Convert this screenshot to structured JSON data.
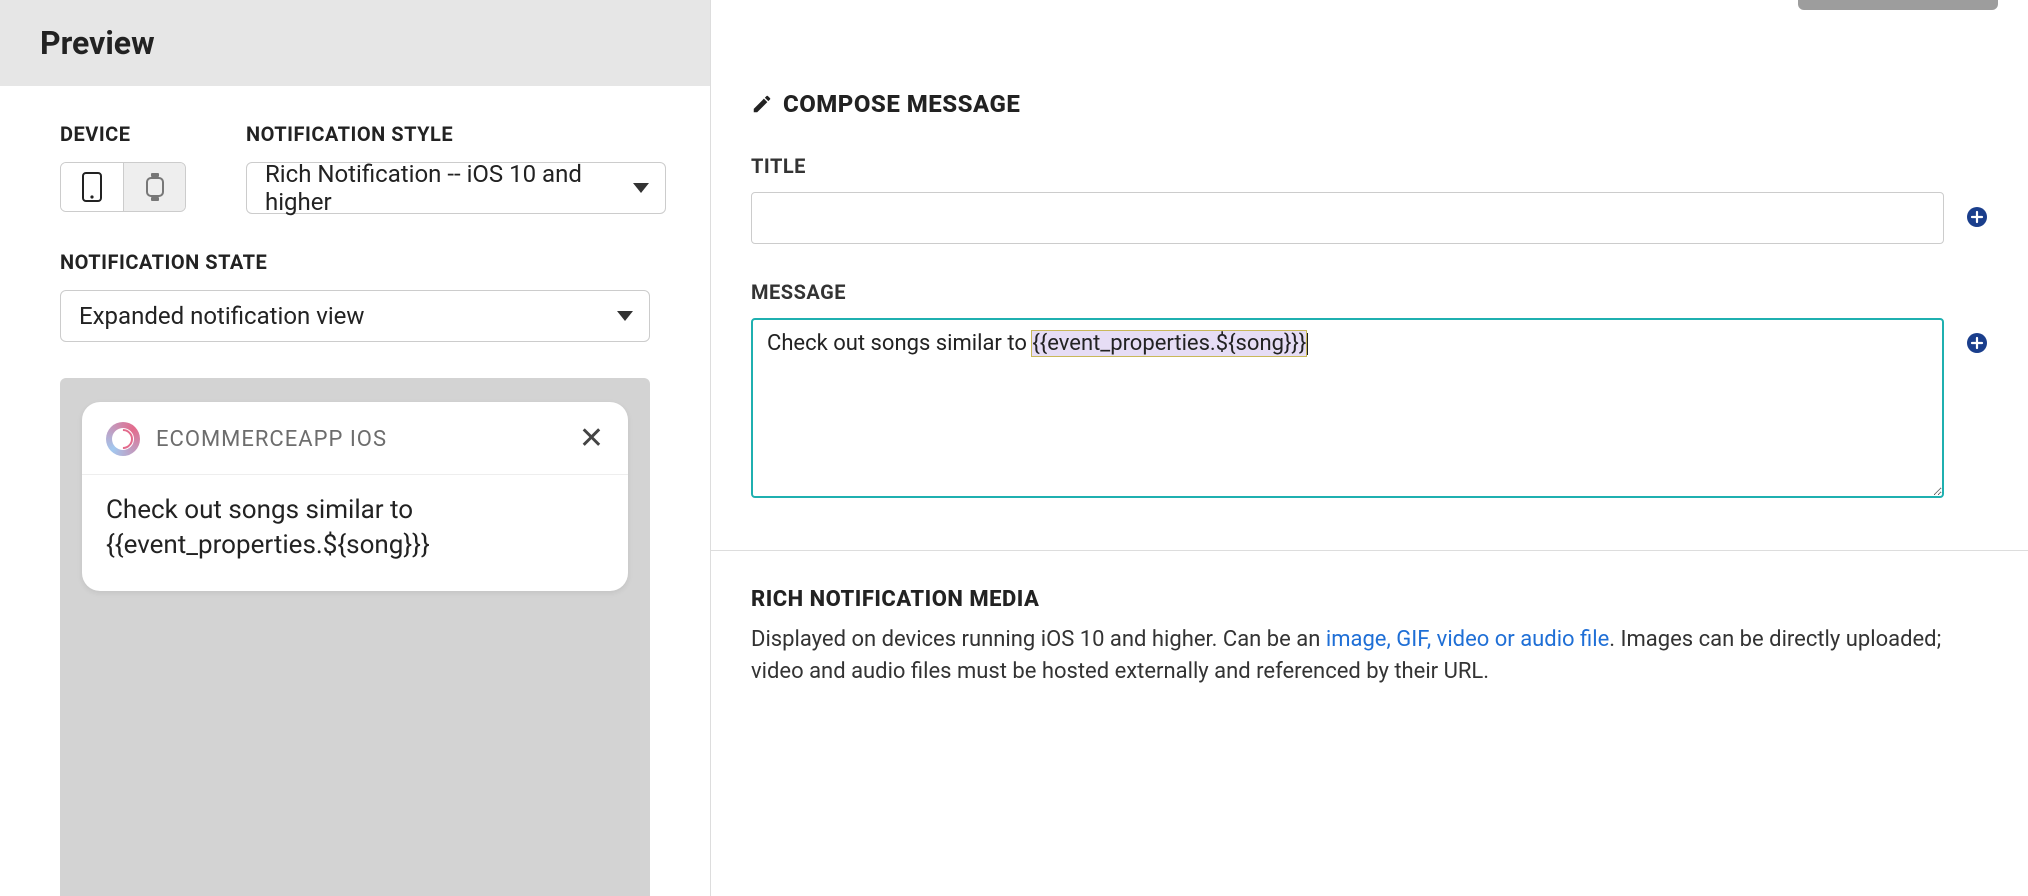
{
  "preview": {
    "header": "Preview",
    "device_label": "DEVICE",
    "style_label": "NOTIFICATION STYLE",
    "style_value": " Rich Notification -- iOS 10 and higher ",
    "state_label": "NOTIFICATION STATE",
    "state_value": " Expanded notification view",
    "notification": {
      "app_name": "ECOMMERCEAPP IOS",
      "body": "Check out songs similar to {{event_properties.${song}}}"
    }
  },
  "compose": {
    "heading": "COMPOSE MESSAGE",
    "title_label": "TITLE",
    "title_value": "",
    "message_label": "MESSAGE",
    "message_prefix": "Check out songs similar to ",
    "message_var": "{{event_properties.${song}}}"
  },
  "rich": {
    "heading": "RICH NOTIFICATION MEDIA",
    "text_before": "Displayed on devices running iOS 10 and higher. Can be an ",
    "link_text": "image, GIF, video or audio file",
    "text_after": ". Images can be directly uploaded; video and audio files must be hosted externally and referenced by their URL."
  }
}
